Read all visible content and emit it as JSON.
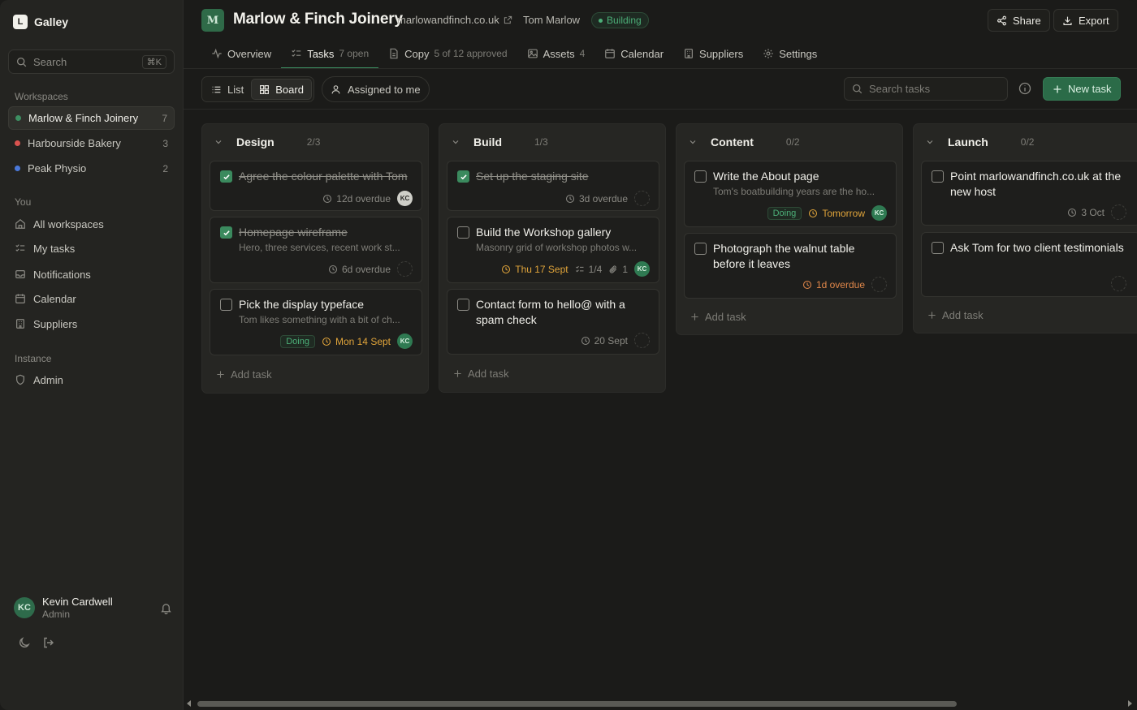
{
  "sidebar": {
    "app_name": "Galley",
    "logo_letter": "L",
    "search_placeholder": "Search",
    "search_shortcut": "⌘K",
    "workspaces_label": "Workspaces",
    "workspaces": [
      {
        "name": "Marlow & Finch Joinery",
        "count": "7",
        "color": "#3d8f62"
      },
      {
        "name": "Harbourside Bakery",
        "count": "3",
        "color": "#d9534f"
      },
      {
        "name": "Peak Physio",
        "count": "2",
        "color": "#4a78d9"
      }
    ],
    "you_label": "You",
    "you_items": [
      "All workspaces",
      "My tasks",
      "Notifications",
      "Calendar",
      "Suppliers"
    ],
    "instance_label": "Instance",
    "instance_items": [
      "Admin"
    ],
    "user": {
      "initials": "KC",
      "name": "Kevin Cardwell",
      "role": "Admin"
    }
  },
  "header": {
    "logo_letter": "M",
    "title": "Marlow & Finch Joinery",
    "url": "marlowandfinch.co.uk",
    "owner": "Tom Marlow",
    "status": "Building",
    "share_label": "Share",
    "export_label": "Export"
  },
  "tabs": [
    {
      "label": "Overview",
      "sub": ""
    },
    {
      "label": "Tasks",
      "sub": "7 open"
    },
    {
      "label": "Copy",
      "sub": "5 of 12 approved"
    },
    {
      "label": "Assets",
      "sub": "4"
    },
    {
      "label": "Calendar",
      "sub": ""
    },
    {
      "label": "Suppliers",
      "sub": ""
    },
    {
      "label": "Settings",
      "sub": ""
    }
  ],
  "toolbar": {
    "list_label": "List",
    "board_label": "Board",
    "assigned_label": "Assigned to me",
    "search_placeholder": "Search tasks",
    "new_task_label": "New task"
  },
  "board": {
    "add_task_label": "Add task",
    "columns": [
      {
        "name": "Design",
        "count": "2/3",
        "cards": [
          {
            "title": "Agree the colour palette with Tom",
            "done": true,
            "desc": "",
            "due": "12d overdue",
            "assignee": "KC"
          },
          {
            "title": "Homepage wireframe",
            "done": true,
            "desc": "Hero, three services, recent work st...",
            "due": "6d overdue",
            "assignee": ""
          },
          {
            "title": "Pick the display typeface",
            "done": false,
            "desc": "Tom likes something with a bit of ch...",
            "badge": "Doing",
            "due": "Mon 14 Sept",
            "assignee": "KC"
          }
        ]
      },
      {
        "name": "Build",
        "count": "1/3",
        "cards": [
          {
            "title": "Set up the staging site",
            "done": true,
            "desc": "",
            "due": "3d overdue",
            "assignee": ""
          },
          {
            "title": "Build the Workshop gallery",
            "done": false,
            "desc": "Masonry grid of workshop photos w...",
            "due": "Thu 17 Sept",
            "subtasks": "1/4",
            "attachments": "1",
            "assignee": "KC"
          },
          {
            "title": "Contact form to hello@ with a spam check",
            "done": false,
            "desc": "",
            "due": "20 Sept",
            "assignee": ""
          }
        ]
      },
      {
        "name": "Content",
        "count": "0/2",
        "cards": [
          {
            "title": "Write the About page",
            "done": false,
            "desc": "Tom's boatbuilding years are the ho...",
            "badge": "Doing",
            "due": "Tomorrow",
            "assignee": "KC"
          },
          {
            "title": "Photograph the walnut table before it leaves",
            "done": false,
            "desc": "",
            "due": "1d overdue",
            "assignee": ""
          }
        ]
      },
      {
        "name": "Launch",
        "count": "0/2",
        "cards": [
          {
            "title": "Point marlowandfinch.co.uk at the new host",
            "done": false,
            "desc": "",
            "due": "3 Oct",
            "assignee": ""
          },
          {
            "title": "Ask Tom for two client testimonials",
            "done": false,
            "desc": "",
            "due": "",
            "assignee": ""
          }
        ]
      }
    ]
  }
}
